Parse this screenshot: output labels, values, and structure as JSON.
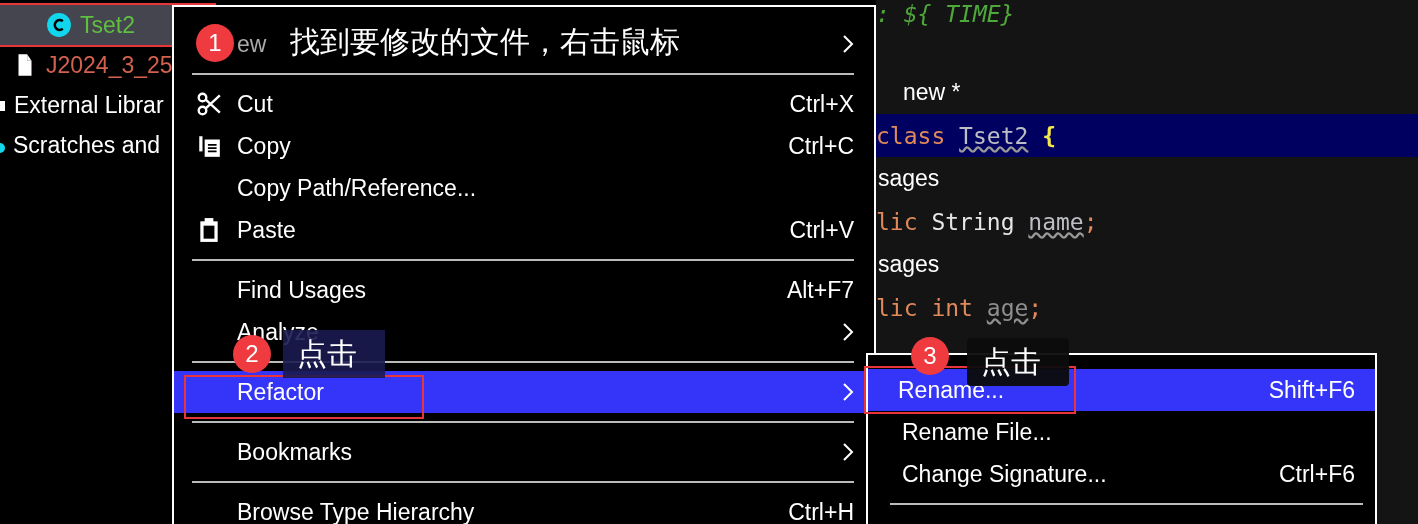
{
  "project_tree": [
    {
      "label": "Tset2",
      "kind": "class",
      "selected": true,
      "annotated": true
    },
    {
      "label": "J2024_3_25",
      "kind": "file",
      "selected": false,
      "annotated": false
    },
    {
      "label": "External Librar",
      "kind": "library",
      "selected": false,
      "annotated": false
    },
    {
      "label": "Scratches and",
      "kind": "scratch",
      "selected": false,
      "annotated": false
    }
  ],
  "context_menu": [
    {
      "kind": "item",
      "label": "ew",
      "dimmed": true,
      "submenu": true,
      "selected": false,
      "annotated": false
    },
    {
      "kind": "separator"
    },
    {
      "kind": "scissors",
      "label": "Cut",
      "shortcut": "Ctrl+X",
      "selected": false,
      "annotated": false
    },
    {
      "kind": "copy",
      "label": "Copy",
      "shortcut": "Ctrl+C",
      "selected": false,
      "annotated": false
    },
    {
      "kind": "item",
      "label": "Copy Path/Reference...",
      "selected": false,
      "annotated": false
    },
    {
      "kind": "paste",
      "label": "Paste",
      "shortcut": "Ctrl+V",
      "selected": false,
      "annotated": false
    },
    {
      "kind": "separator"
    },
    {
      "kind": "item",
      "label": "Find Usages",
      "shortcut": "Alt+F7",
      "selected": false,
      "annotated": false
    },
    {
      "kind": "item",
      "label": "Analyze",
      "submenu": true,
      "selected": false,
      "annotated": false
    },
    {
      "kind": "separator"
    },
    {
      "kind": "item",
      "label": "Refactor",
      "submenu": true,
      "selected": true,
      "annotated": true
    },
    {
      "kind": "separator"
    },
    {
      "kind": "item",
      "label": "Bookmarks",
      "submenu": true,
      "selected": false,
      "annotated": false
    },
    {
      "kind": "separator"
    },
    {
      "kind": "item",
      "label": "Browse Type Hierarchy",
      "shortcut": "Ctrl+H",
      "selected": false,
      "annotated": false
    }
  ],
  "submenu": [
    {
      "kind": "item",
      "label": "Rename...",
      "shortcut": "Shift+F6",
      "selected": true,
      "annotated": true
    },
    {
      "kind": "item",
      "label": "Rename File...",
      "selected": false,
      "annotated": false
    },
    {
      "kind": "item",
      "label": "Change Signature...",
      "shortcut": "Ctrl+F6",
      "selected": false,
      "annotated": false
    },
    {
      "kind": "separator"
    }
  ],
  "editor_lines": [
    {
      "highlighted": false,
      "tokens": [
        {
          "kind": "comment",
          "text": ": ${ TIME}"
        }
      ]
    },
    {
      "highlighted": false
    },
    {
      "highlighted": false,
      "tokens": [
        {
          "kind": "hint",
          "text": "new *"
        }
      ]
    },
    {
      "highlighted": true,
      "tokens": [
        {
          "kind": "keyword",
          "text": "class "
        },
        {
          "kind": "warned",
          "text": "Tset2"
        },
        {
          "kind": "brace",
          "text": " {"
        }
      ]
    },
    {
      "highlighted": false,
      "tokens": [
        {
          "kind": "hint",
          "text": "sages"
        }
      ]
    },
    {
      "highlighted": false,
      "tokens": [
        {
          "kind": "keyword",
          "text": "lic "
        },
        {
          "kind": "text",
          "text": "String  "
        },
        {
          "kind": "warned",
          "text": "name"
        },
        {
          "kind": "keyword",
          "text": ";"
        }
      ]
    },
    {
      "highlighted": false,
      "tokens": [
        {
          "kind": "hint",
          "text": "sages"
        }
      ]
    },
    {
      "highlighted": false,
      "tokens": [
        {
          "kind": "keyword",
          "text": "lic int "
        },
        {
          "kind": "unused",
          "text": "age"
        },
        {
          "kind": "keyword",
          "text": ";"
        }
      ]
    }
  ],
  "annotations": [
    {
      "number": "1",
      "text": "找到要修改的文件，右击鼠标",
      "kind": "plain"
    },
    {
      "number": "2",
      "text": "点击",
      "kind": "boxed"
    },
    {
      "number": "3",
      "text": "点击",
      "kind": "pointer"
    }
  ]
}
